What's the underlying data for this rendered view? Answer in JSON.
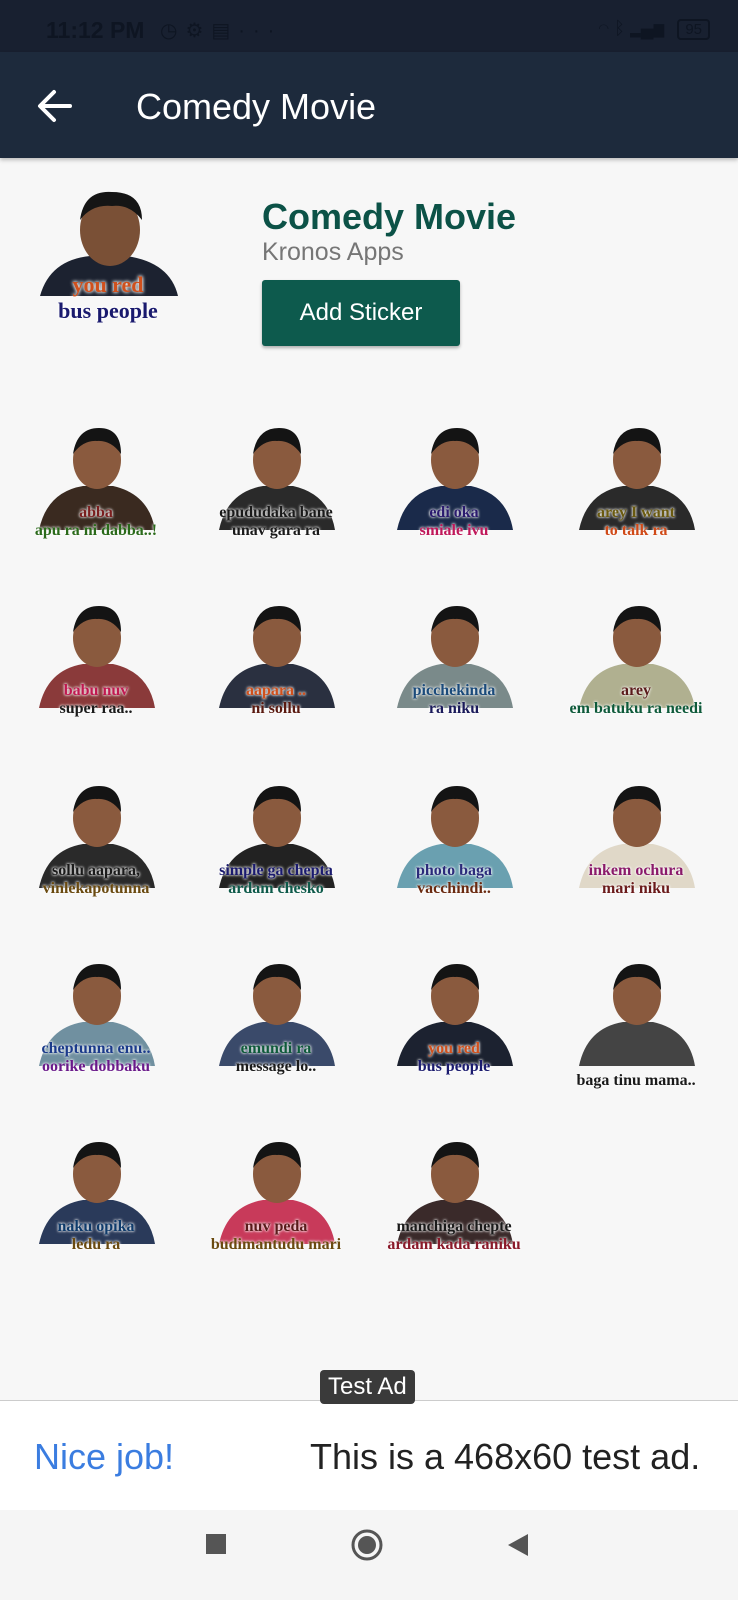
{
  "status_bar": {
    "time": "11:12 PM",
    "battery": "95"
  },
  "app_bar": {
    "title": "Comedy Movie"
  },
  "pack": {
    "title": "Comedy Movie",
    "publisher": "Kronos Apps",
    "add_button_label": "Add Sticker",
    "tray_caption": [
      "you red",
      "bus people"
    ]
  },
  "stickers": [
    {
      "lines": [
        "abba",
        "apu ra ni dabba..!"
      ]
    },
    {
      "lines": [
        "epududaka bane",
        "unav gara ra"
      ]
    },
    {
      "lines": [
        "edi oka",
        "smiale ivu"
      ]
    },
    {
      "lines": [
        "arey I want",
        "to talk ra"
      ]
    },
    {
      "lines": [
        "babu nuv",
        "super raa.."
      ]
    },
    {
      "lines": [
        "aapara ..",
        "ni sollu"
      ]
    },
    {
      "lines": [
        "picchekinda",
        "ra niku"
      ]
    },
    {
      "lines": [
        "arey",
        "em batuku ra needi"
      ]
    },
    {
      "lines": [
        "sollu aapara,",
        "vinlekapotunna"
      ]
    },
    {
      "lines": [
        "simple ga chepta",
        "ardam chesko"
      ]
    },
    {
      "lines": [
        "photo baga",
        "vacchindi.."
      ]
    },
    {
      "lines": [
        "inkem ochura",
        "mari niku"
      ]
    },
    {
      "lines": [
        "cheptunna enu..",
        "oorike dobbaku"
      ]
    },
    {
      "lines": [
        "emundi ra",
        "message lo.."
      ]
    },
    {
      "lines": [
        "you red",
        "bus people"
      ]
    },
    {
      "lines": [
        "baga tinu mama.."
      ]
    },
    {
      "lines": [
        "naku opika",
        "ledu ra"
      ]
    },
    {
      "lines": [
        "nuv peda",
        "budimantudu mari"
      ]
    },
    {
      "lines": [
        "manchiga chepte",
        "ardam kada raniku"
      ]
    }
  ],
  "ad": {
    "tag": "Test Ad",
    "headline": "Nice job!",
    "body": "This is a 468x60 test ad."
  },
  "nav": {
    "icons": [
      "recents-square-icon",
      "home-circle-icon",
      "back-triangle-icon"
    ]
  }
}
